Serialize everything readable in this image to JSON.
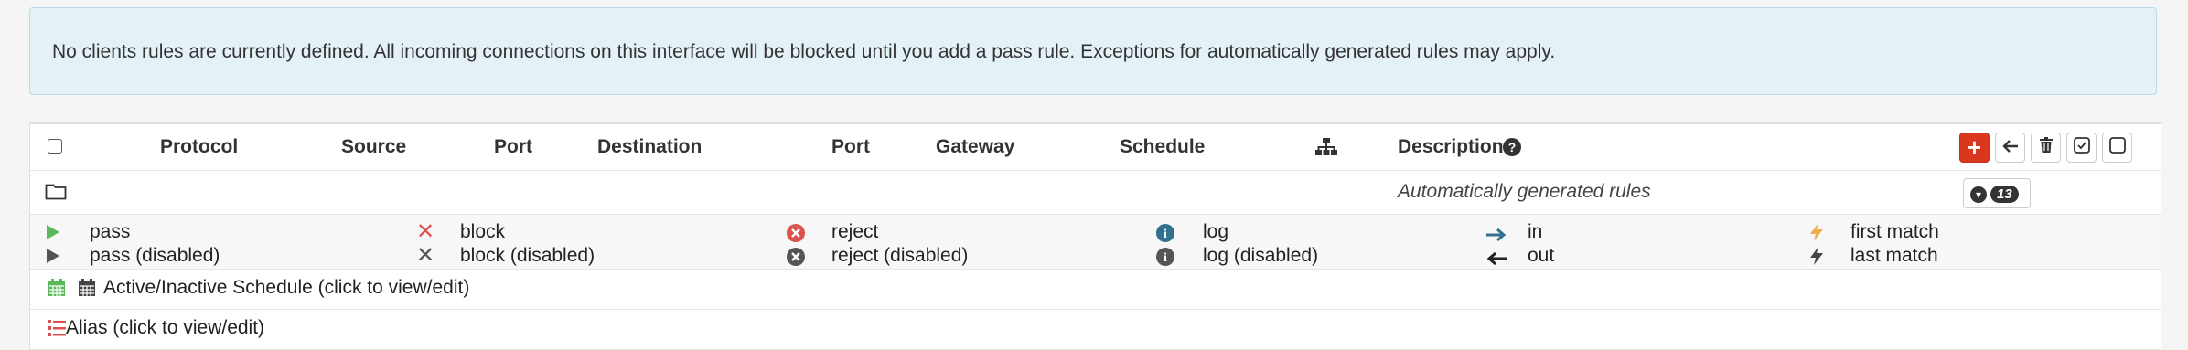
{
  "alert": {
    "message": "No clients rules are currently defined. All incoming connections on this interface will be blocked until you add a pass rule. Exceptions for automatically generated rules may apply."
  },
  "table": {
    "headers": {
      "protocol": "Protocol",
      "source": "Source",
      "port": "Port",
      "destination": "Destination",
      "port2": "Port",
      "gateway": "Gateway",
      "schedule": "Schedule",
      "description": "Description"
    },
    "auto_rules": {
      "label": "Automatically generated rules",
      "count": "13"
    }
  },
  "legend": {
    "pass": "pass",
    "pass_disabled": "pass (disabled)",
    "block": "block",
    "block_disabled": "block (disabled)",
    "reject": "reject",
    "reject_disabled": "reject (disabled)",
    "log": "log",
    "log_disabled": "log (disabled)",
    "in": "in",
    "out": "out",
    "first_match": "first match",
    "last_match": "last match",
    "schedule": "Active/Inactive Schedule (click to view/edit)",
    "alias": "Alias (click to view/edit)"
  },
  "colors": {
    "pass": "#5cb85c",
    "block": "#d9534f",
    "reject": "#d9534f",
    "log": "#31708f",
    "add_button": "#d9381e",
    "lightning": "#f0ad4e"
  },
  "icons": [
    "info-icon",
    "sitemap-icon",
    "folder-icon",
    "chevron-down-icon",
    "plus-icon",
    "arrow-left-icon",
    "trash-icon",
    "check-square-icon",
    "square-icon",
    "play-icon",
    "times-icon",
    "times-circle-icon",
    "info-circle-icon",
    "arrow-right-icon",
    "bolt-icon",
    "calendar-icon",
    "list-icon"
  ]
}
